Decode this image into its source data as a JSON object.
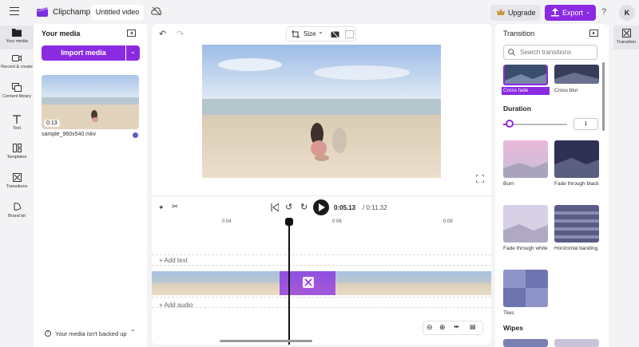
{
  "app": {
    "brand": "Clipchamp",
    "project_title": "Untitled video",
    "upgrade_label": "Upgrade",
    "export_label": "Export",
    "help_label": "?",
    "avatar_initial": "K",
    "accent": "#8a2be2"
  },
  "nav": {
    "items": [
      {
        "label": "Your media",
        "icon": "folder-icon",
        "active": true
      },
      {
        "label": "Record & create",
        "icon": "camera-icon"
      },
      {
        "label": "Content library",
        "icon": "library-icon"
      },
      {
        "label": "Text",
        "icon": "text-icon"
      },
      {
        "label": "Templates",
        "icon": "templates-icon"
      },
      {
        "label": "Transitions",
        "icon": "transitions-icon"
      },
      {
        "label": "Brand kit",
        "icon": "brand-kit-icon"
      }
    ]
  },
  "media": {
    "title": "Your media",
    "import_label": "Import media",
    "file": {
      "duration": "0:13",
      "name": "sample_960x540.mkv"
    },
    "backup_text": "Your media isn't backed up"
  },
  "preview": {
    "size_label": "Size"
  },
  "timeline": {
    "current_time": "0:05.13",
    "total_time": "/ 0:11.32",
    "ruler": [
      "0:04",
      "0:06",
      "0:08"
    ],
    "add_text": "+ Add text",
    "add_audio": "+ Add audio"
  },
  "transitions": {
    "title": "Transition",
    "search_placeholder": "Search transitions",
    "top_row": [
      {
        "label": "Cross fade",
        "selected": true
      },
      {
        "label": "Cross blur"
      }
    ],
    "duration_label": "Duration",
    "duration_value": "1",
    "duration_fraction": 0.1,
    "cards": [
      {
        "label": "Burn"
      },
      {
        "label": "Fade through black"
      },
      {
        "label": "Fade through white"
      },
      {
        "label": "Horizontal banding"
      },
      {
        "label": "Tiles"
      }
    ],
    "wipes_label": "Wipes"
  },
  "right_strip": {
    "label": "Transition"
  }
}
